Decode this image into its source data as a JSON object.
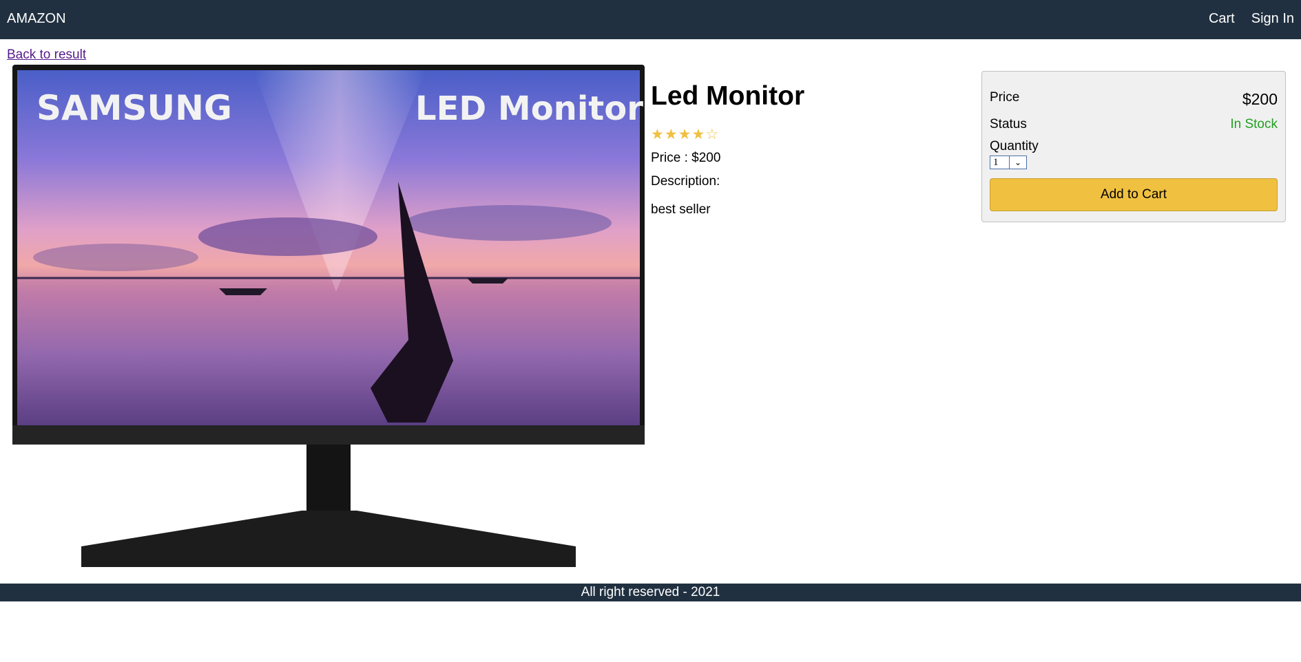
{
  "header": {
    "brand": "AMAZON",
    "nav": {
      "cart": "Cart",
      "sign_in": "Sign In"
    }
  },
  "back_link": "Back to result",
  "product": {
    "image_text": {
      "brand": "SAMSUNG",
      "tagline": "LED Monitor"
    },
    "title": "Led Monitor",
    "rating": {
      "value": 4,
      "max": 5
    },
    "price_line": "Price : $200",
    "description_label": "Description:",
    "description": "best seller"
  },
  "cart_box": {
    "price_label": "Price",
    "price_value": "$200",
    "status_label": "Status",
    "status_value": "In Stock",
    "quantity_label": "Quantity",
    "quantity_value": "1",
    "add_button": "Add to Cart"
  },
  "footer": {
    "text": "All right reserved - 2021"
  },
  "colors": {
    "header_bg": "#203040",
    "accent": "#f0c040",
    "in_stock": "#20a020"
  },
  "icons": {
    "star_full": "★",
    "star_empty": "☆",
    "chevron": "chevron-down-icon"
  }
}
